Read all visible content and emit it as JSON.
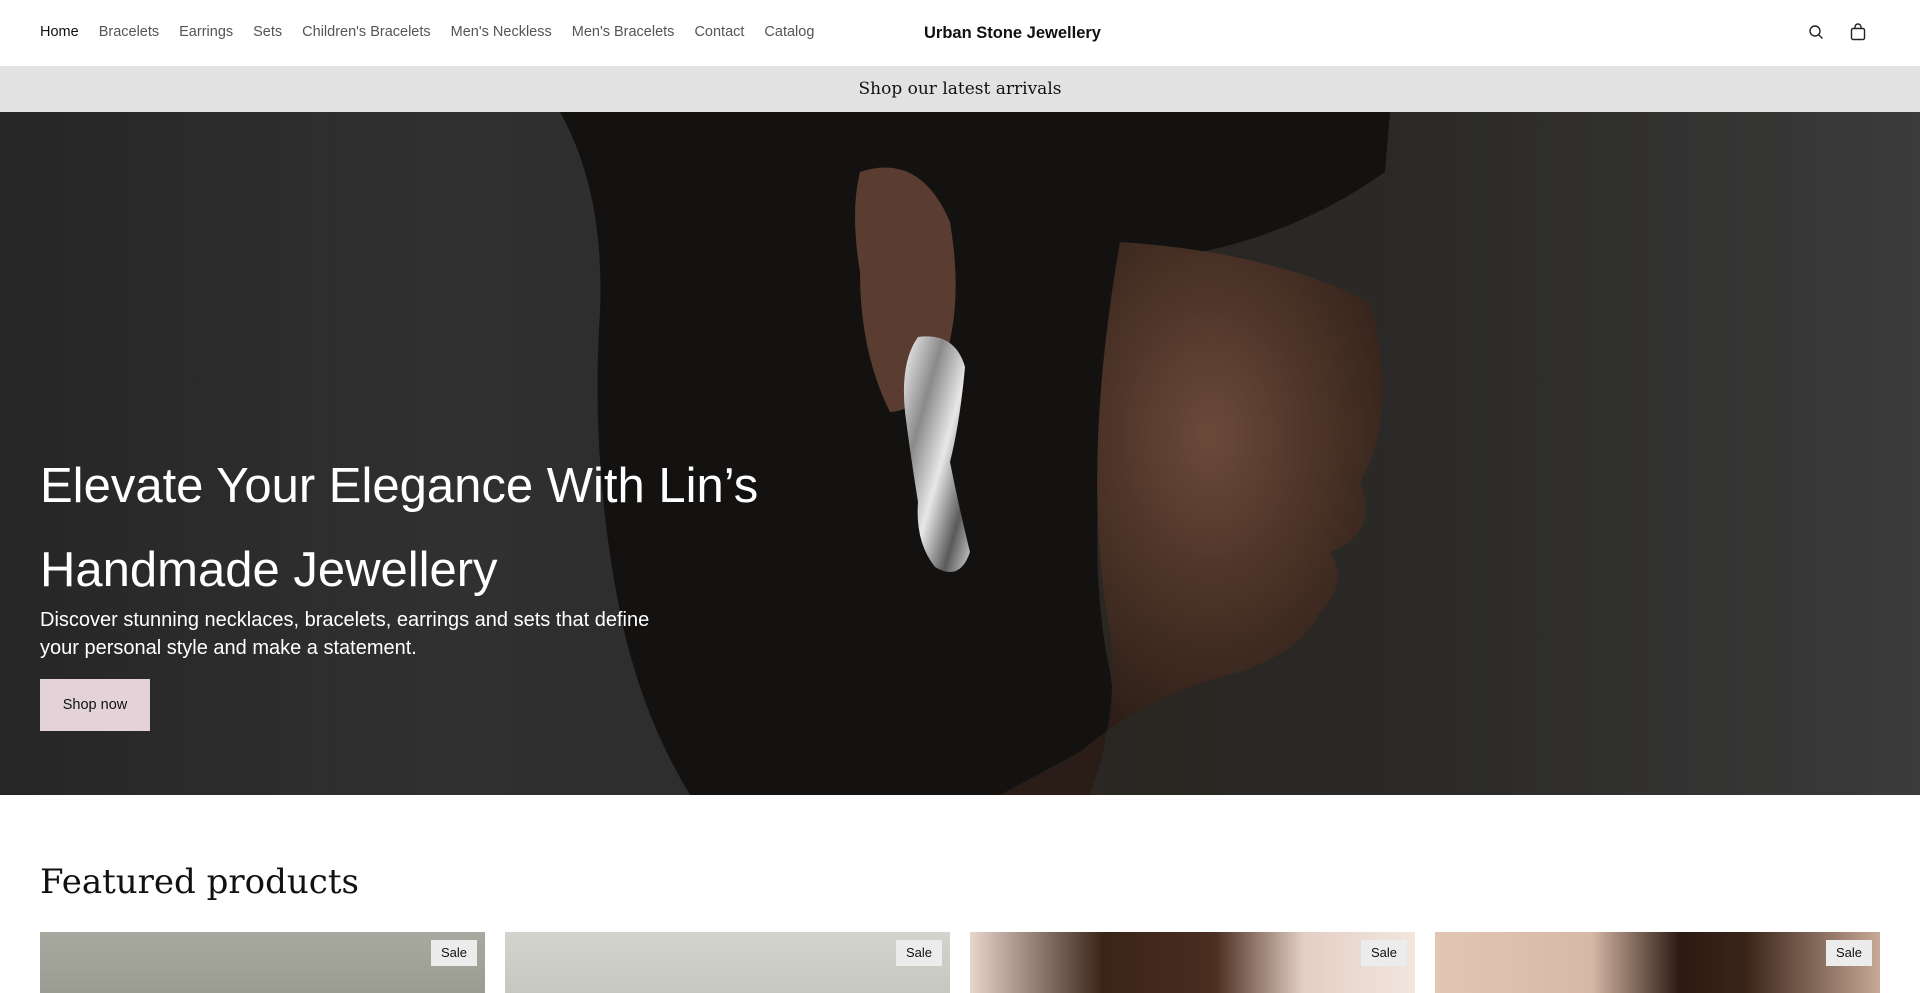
{
  "nav": {
    "items": [
      {
        "label": "Home",
        "active": true
      },
      {
        "label": "Bracelets",
        "active": false
      },
      {
        "label": "Earrings",
        "active": false
      },
      {
        "label": "Sets",
        "active": false
      },
      {
        "label": "Children's Bracelets",
        "active": false
      },
      {
        "label": "Men's Neckless",
        "active": false
      },
      {
        "label": "Men's Bracelets",
        "active": false
      },
      {
        "label": "Contact",
        "active": false
      },
      {
        "label": "Catalog",
        "active": false
      }
    ]
  },
  "brand": "Urban Stone Jewellery",
  "header_icons": [
    "search-icon",
    "shopping-bag-icon"
  ],
  "announcement": "Shop our latest arrivals",
  "hero": {
    "title": "Elevate Your Elegance With Lin’s Handmade Jewellery",
    "subtitle": "Discover stunning necklaces, bracelets, earrings and sets that define your personal style and make a statement.",
    "button_label": "Shop now"
  },
  "featured": {
    "title": "Featured products",
    "products": [
      {
        "badge": "Sale"
      },
      {
        "badge": "Sale"
      },
      {
        "badge": "Sale"
      },
      {
        "badge": "Sale"
      }
    ]
  },
  "colors": {
    "announcement_bg": "#e2e2e2",
    "button_bg": "#e3d3d8",
    "badge_bg": "#ececec"
  }
}
